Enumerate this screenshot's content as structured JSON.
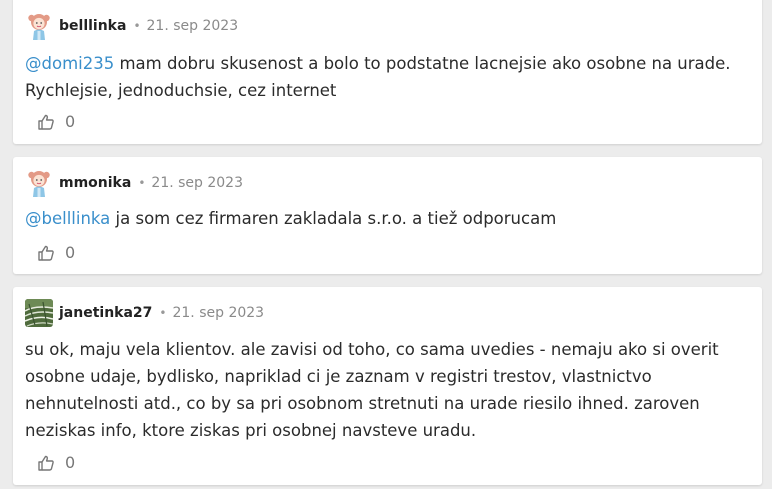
{
  "comments": [
    {
      "author": "belllinka",
      "separator": "•",
      "date": "21. sep 2023",
      "avatar_icon": "girl-avatar-icon",
      "mention": "@domi235",
      "text": " mam dobru skusenost a bolo to podstatne lacnejsie ako osobne na urade. Rychlejsie, jednoduchsie, cez internet",
      "likes": "0"
    },
    {
      "author": "mmonika",
      "separator": "•",
      "date": "21. sep 2023",
      "avatar_icon": "girl-avatar-icon",
      "mention": "@belllinka",
      "text": " ja som cez firmaren zakladala s.r.o. a tiež odporucam",
      "likes": "0"
    },
    {
      "author": "janetinka27",
      "separator": "•",
      "date": "21. sep 2023",
      "avatar_icon": "photo-avatar-icon",
      "mention": "",
      "text": "su ok, maju vela klientov. ale zavisi od toho, co sama uvedies - nemaju ako si overit osobne udaje, bydlisko, napriklad ci je zaznam v registri trestov, vlastnictvo nehnutelnosti atd., co by sa pri osobnom stretnuti na urade riesilo ihned. zaroven neziskas info, ktore ziskas pri osobnej navsteve uradu.",
      "likes": "0"
    }
  ],
  "colors": {
    "mention": "#3a8fcb",
    "background": "#ececec",
    "card": "#ffffff"
  }
}
